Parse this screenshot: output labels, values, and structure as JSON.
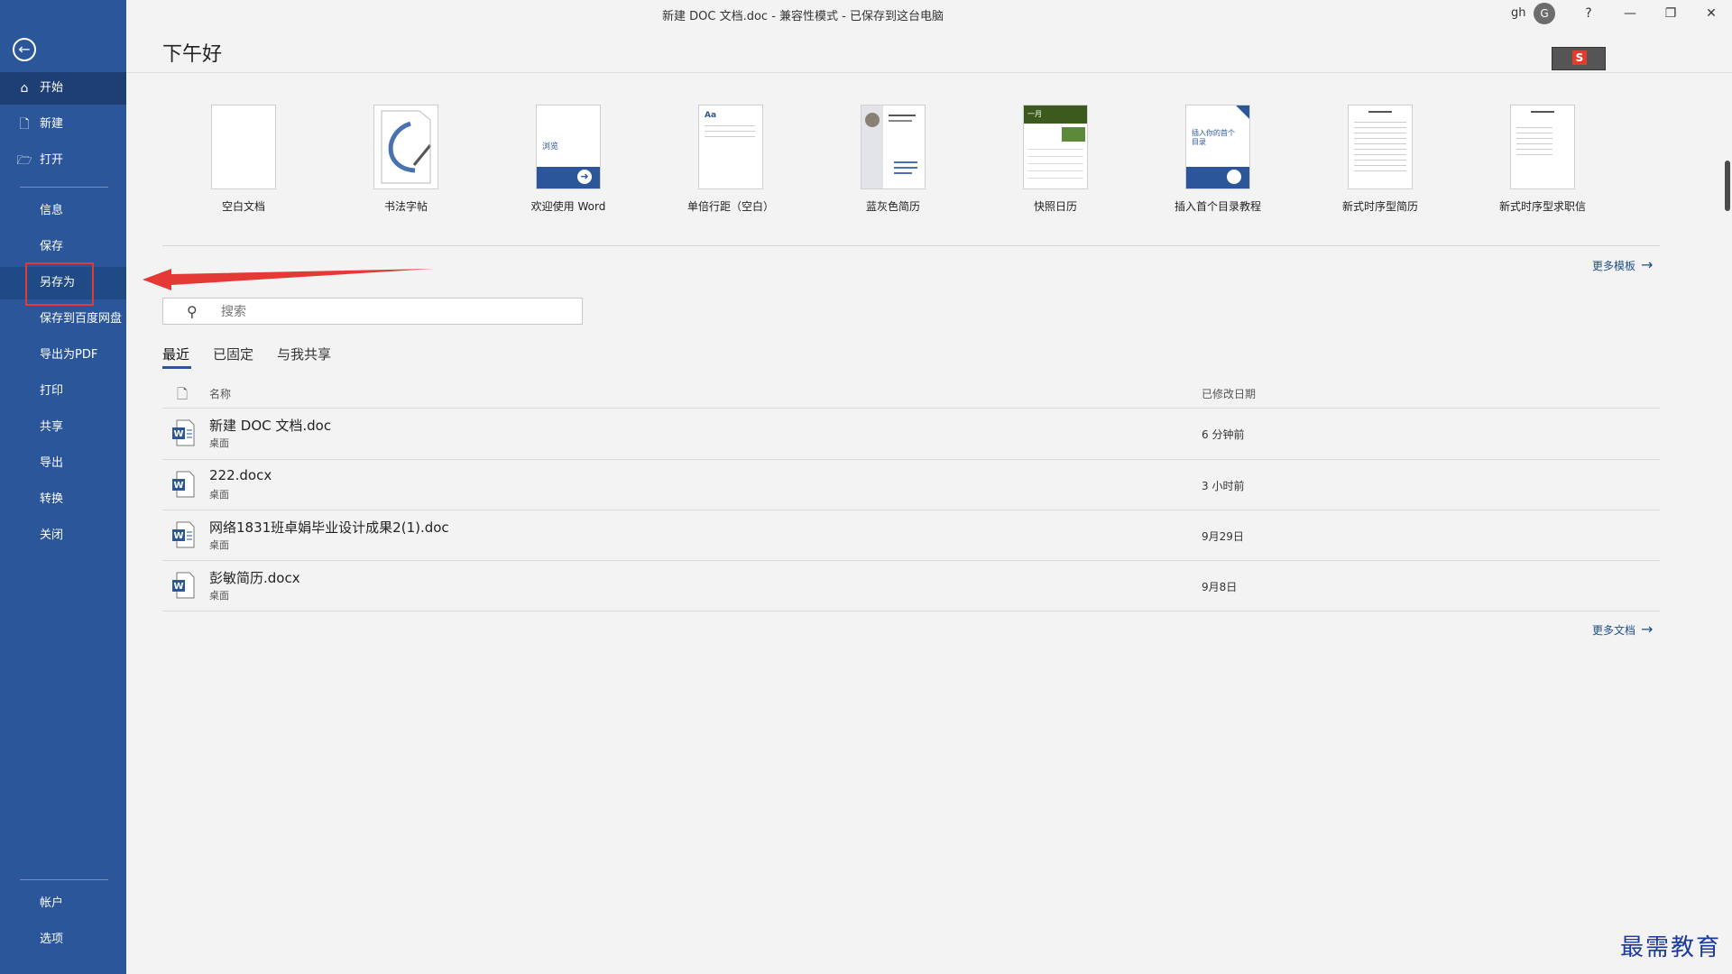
{
  "window": {
    "title": "新建 DOC 文档.doc  -  兼容性模式 - 已保存到这台电脑",
    "user": "gh",
    "avatar_letter": "G",
    "help": "?",
    "minimize": "—",
    "restore": "❐",
    "close": "✕"
  },
  "greeting": "下午好",
  "sidebar": {
    "items": [
      {
        "label": "开始",
        "icon": "home-icon"
      },
      {
        "label": "新建",
        "icon": "new-doc-icon"
      },
      {
        "label": "打开",
        "icon": "folder-open-icon"
      },
      {
        "label": "信息"
      },
      {
        "label": "保存"
      },
      {
        "label": "另存为"
      },
      {
        "label": "保存到百度网盘"
      },
      {
        "label": "导出为PDF"
      },
      {
        "label": "打印"
      },
      {
        "label": "共享"
      },
      {
        "label": "导出"
      },
      {
        "label": "转换"
      },
      {
        "label": "关闭"
      }
    ],
    "bottom": [
      {
        "label": "帐户"
      },
      {
        "label": "选项"
      }
    ]
  },
  "templates": [
    {
      "label": "空白文档"
    },
    {
      "label": "书法字帖"
    },
    {
      "label": "欢迎使用 Word",
      "thumb_text": "浏览"
    },
    {
      "label": "单倍行距（空白）",
      "thumb_text": "Aa"
    },
    {
      "label": "蓝灰色简历"
    },
    {
      "label": "快照日历",
      "thumb_text": "一月"
    },
    {
      "label": "插入首个目录教程",
      "thumb_text": "插入你的首个 目录"
    },
    {
      "label": "新式时序型简历"
    },
    {
      "label": "新式时序型求职信"
    }
  ],
  "more_templates": "更多模板",
  "search": {
    "placeholder": "搜索"
  },
  "tabs": [
    "最近",
    "已固定",
    "与我共享"
  ],
  "columns": {
    "name": "名称",
    "modified": "已修改日期"
  },
  "files": [
    {
      "name": "新建 DOC 文档.doc",
      "location": "桌面",
      "modified": "6 分钟前"
    },
    {
      "name": "222.docx",
      "location": "桌面",
      "modified": "3 小时前"
    },
    {
      "name": "网络1831班卓娟毕业设计成果2(1).doc",
      "location": "桌面",
      "modified": "9月29日"
    },
    {
      "name": "彭敏简历.docx",
      "location": "桌面",
      "modified": "9月8日"
    }
  ],
  "more_docs": "更多文档",
  "watermark": "最需教育",
  "colors": {
    "sidebar": "#2b579a",
    "accent": "#2b579a",
    "annotation": "#e53935"
  }
}
